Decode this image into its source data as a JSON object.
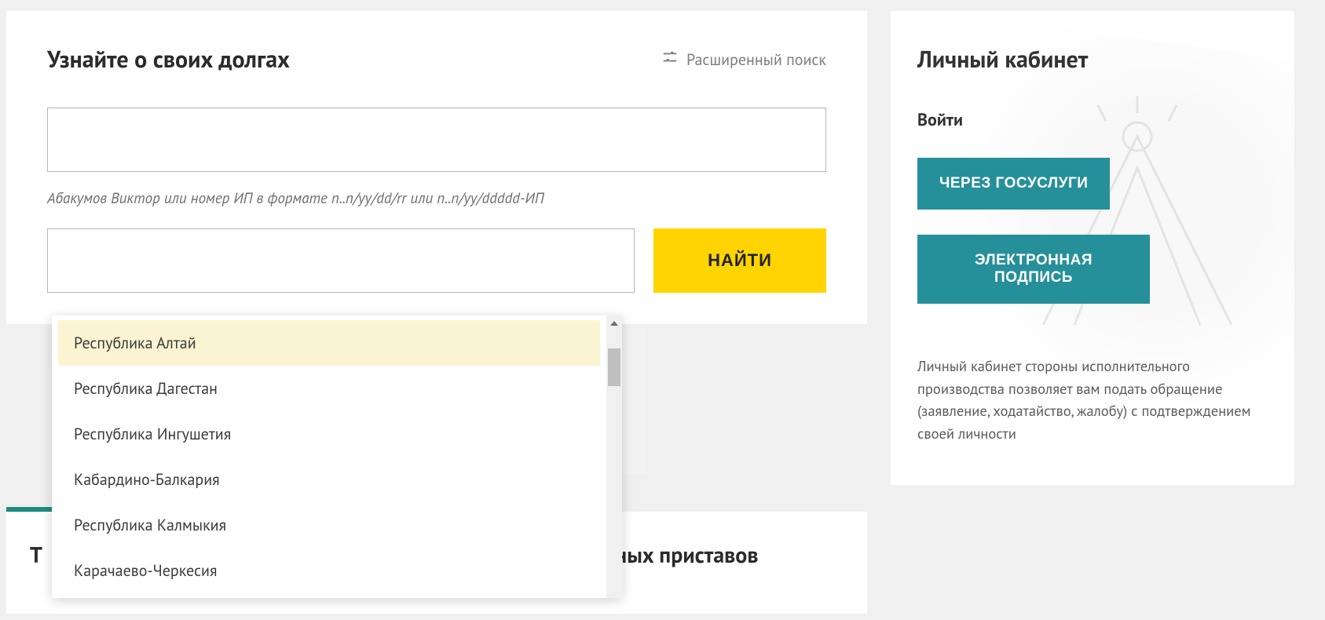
{
  "search": {
    "title": "Узнайте о своих долгах",
    "advanced_label": "Расширенный поиск",
    "input1_value": "",
    "hint": "Абакумов Виктор или номер ИП в формате n..n/yy/dd/rr или n..n/yy/ddddd-ИП",
    "input2_value": "",
    "submit_label": "НАЙТИ",
    "dropdown": {
      "options": [
        "Республика Алтай",
        "Республика Дагестан",
        "Республика Ингушетия",
        "Кабардино-Балкария",
        "Республика Калмыкия",
        "Карачаево-Черкесия"
      ],
      "highlighted_index": 0
    }
  },
  "cabinet": {
    "title": "Личный кабинет",
    "login_label": "Войти",
    "btn_gosuslugi": "ЧЕРЕЗ ГОСУСЛУГИ",
    "btn_signature": "ЭЛЕКТРОННАЯ ПОДПИСЬ",
    "description": "Личный кабинет стороны исполнительного производства позволяет вам подать обращение (заявление, ходатайство, жалобу) с подтверждением своей личности"
  },
  "bottom": {
    "left_initial": "Т",
    "right_fragment": "дебных приставов"
  },
  "colors": {
    "accent_yellow": "#ffd400",
    "accent_teal": "#26909a",
    "accent_green": "#1e8c7a"
  }
}
